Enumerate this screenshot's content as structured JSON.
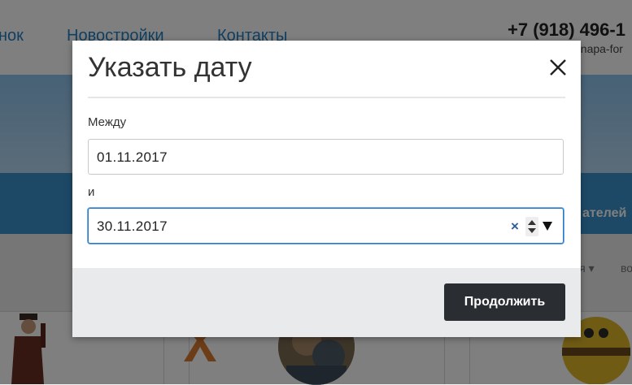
{
  "background": {
    "nav": [
      {
        "label": "нок"
      },
      {
        "label": "Новостройки"
      },
      {
        "label": "Контакты"
      }
    ],
    "phone": "+7 (918) 496-1",
    "site_url": "anapa-for",
    "band_text": "ателей",
    "filters": [
      {
        "label": "ля ▾"
      },
      {
        "label": "во"
      }
    ]
  },
  "modal": {
    "title": "Указать дату",
    "from_label": "Между",
    "from_value": "01.11.2017",
    "to_label": "и",
    "to_value": "30.11.2017",
    "clear_symbol": "×",
    "continue_label": "Продолжить"
  },
  "colors": {
    "primary_button": "#2a2e33",
    "focus_border": "#2a79c9",
    "nav_link": "#1f7fc3"
  }
}
